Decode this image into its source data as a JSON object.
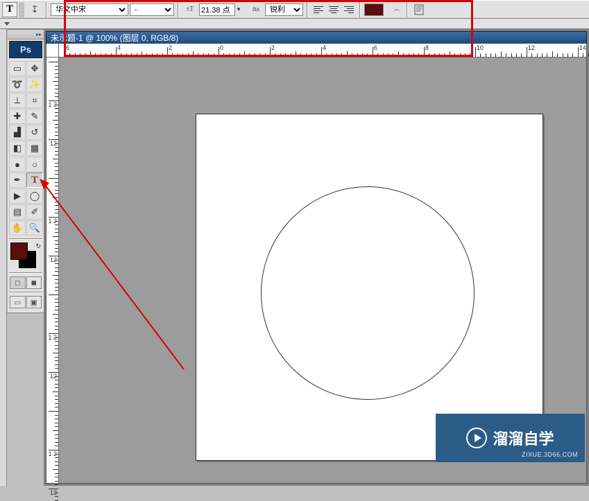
{
  "optionsbar": {
    "tool_letter": "T",
    "font_family": "华文中宋",
    "font_style": "-",
    "font_size": "21.38 点",
    "aa": "锐利",
    "color": "#5a0e0e"
  },
  "document": {
    "title": "未示题-1 @ 100% (图层 0, RGB/8)"
  },
  "toolbox": {
    "ps_label": "Ps",
    "fg_color": "#5a0e0e",
    "bg_color": "#000000"
  },
  "ruler": {
    "h_labels": [
      "6",
      "4",
      "2",
      "0",
      "2",
      "4",
      "6",
      "8",
      "10",
      "12",
      "14"
    ],
    "v_labels": [
      "",
      "1 2",
      "12"
    ]
  },
  "watermark": {
    "brand": "溜溜自学",
    "url": "ZIXUE.3D66.COM"
  }
}
